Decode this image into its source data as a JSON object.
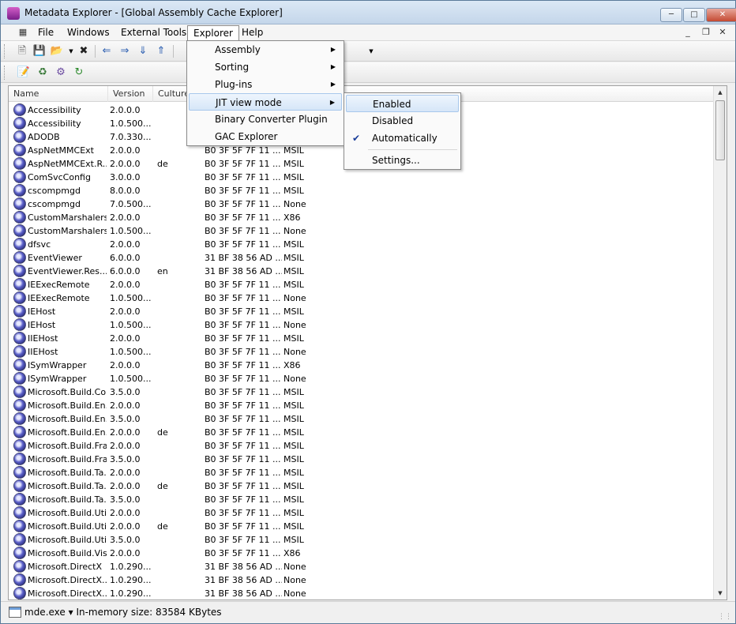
{
  "window": {
    "title": "Metadata Explorer - [Global Assembly Cache Explorer]"
  },
  "menubar": {
    "items": [
      "File",
      "Windows",
      "External Tools",
      "Explorer",
      "Help"
    ]
  },
  "columns": [
    "Name",
    "Version",
    "Culture"
  ],
  "rows": [
    [
      "Accessibility",
      "2.0.0.0",
      "",
      "",
      ""
    ],
    [
      "Accessibility",
      "1.0.500...",
      "",
      "",
      ""
    ],
    [
      "ADODB",
      "7.0.330...",
      "",
      "",
      ""
    ],
    [
      "AspNetMMCExt",
      "2.0.0.0",
      "",
      "B0 3F 5F 7F 11 ...",
      "MSIL"
    ],
    [
      "AspNetMMCExt.R...",
      "2.0.0.0",
      "de",
      "B0 3F 5F 7F 11 ...",
      "MSIL"
    ],
    [
      "ComSvcConfig",
      "3.0.0.0",
      "",
      "B0 3F 5F 7F 11 ...",
      "MSIL"
    ],
    [
      "cscompmgd",
      "8.0.0.0",
      "",
      "B0 3F 5F 7F 11 ...",
      "MSIL"
    ],
    [
      "cscompmgd",
      "7.0.500...",
      "",
      "B0 3F 5F 7F 11 ...",
      "None"
    ],
    [
      "CustomMarshalers",
      "2.0.0.0",
      "",
      "B0 3F 5F 7F 11 ...",
      "X86"
    ],
    [
      "CustomMarshalers",
      "1.0.500...",
      "",
      "B0 3F 5F 7F 11 ...",
      "None"
    ],
    [
      "dfsvc",
      "2.0.0.0",
      "",
      "B0 3F 5F 7F 11 ...",
      "MSIL"
    ],
    [
      "EventViewer",
      "6.0.0.0",
      "",
      "31 BF 38 56 AD ...",
      "MSIL"
    ],
    [
      "EventViewer.Res...",
      "6.0.0.0",
      "en",
      "31 BF 38 56 AD ...",
      "MSIL"
    ],
    [
      "IEExecRemote",
      "2.0.0.0",
      "",
      "B0 3F 5F 7F 11 ...",
      "MSIL"
    ],
    [
      "IEExecRemote",
      "1.0.500...",
      "",
      "B0 3F 5F 7F 11 ...",
      "None"
    ],
    [
      "IEHost",
      "2.0.0.0",
      "",
      "B0 3F 5F 7F 11 ...",
      "MSIL"
    ],
    [
      "IEHost",
      "1.0.500...",
      "",
      "B0 3F 5F 7F 11 ...",
      "None"
    ],
    [
      "IIEHost",
      "2.0.0.0",
      "",
      "B0 3F 5F 7F 11 ...",
      "MSIL"
    ],
    [
      "IIEHost",
      "1.0.500...",
      "",
      "B0 3F 5F 7F 11 ...",
      "None"
    ],
    [
      "ISymWrapper",
      "2.0.0.0",
      "",
      "B0 3F 5F 7F 11 ...",
      "X86"
    ],
    [
      "ISymWrapper",
      "1.0.500...",
      "",
      "B0 3F 5F 7F 11 ...",
      "None"
    ],
    [
      "Microsoft.Build.Co...",
      "3.5.0.0",
      "",
      "B0 3F 5F 7F 11 ...",
      "MSIL"
    ],
    [
      "Microsoft.Build.En...",
      "2.0.0.0",
      "",
      "B0 3F 5F 7F 11 ...",
      "MSIL"
    ],
    [
      "Microsoft.Build.En...",
      "3.5.0.0",
      "",
      "B0 3F 5F 7F 11 ...",
      "MSIL"
    ],
    [
      "Microsoft.Build.En...",
      "2.0.0.0",
      "de",
      "B0 3F 5F 7F 11 ...",
      "MSIL"
    ],
    [
      "Microsoft.Build.Fra...",
      "2.0.0.0",
      "",
      "B0 3F 5F 7F 11 ...",
      "MSIL"
    ],
    [
      "Microsoft.Build.Fra...",
      "3.5.0.0",
      "",
      "B0 3F 5F 7F 11 ...",
      "MSIL"
    ],
    [
      "Microsoft.Build.Ta...",
      "2.0.0.0",
      "",
      "B0 3F 5F 7F 11 ...",
      "MSIL"
    ],
    [
      "Microsoft.Build.Ta...",
      "2.0.0.0",
      "de",
      "B0 3F 5F 7F 11 ...",
      "MSIL"
    ],
    [
      "Microsoft.Build.Ta...",
      "3.5.0.0",
      "",
      "B0 3F 5F 7F 11 ...",
      "MSIL"
    ],
    [
      "Microsoft.Build.Util...",
      "2.0.0.0",
      "",
      "B0 3F 5F 7F 11 ...",
      "MSIL"
    ],
    [
      "Microsoft.Build.Util...",
      "2.0.0.0",
      "de",
      "B0 3F 5F 7F 11 ...",
      "MSIL"
    ],
    [
      "Microsoft.Build.Util...",
      "3.5.0.0",
      "",
      "B0 3F 5F 7F 11 ...",
      "MSIL"
    ],
    [
      "Microsoft.Build.Vis...",
      "2.0.0.0",
      "",
      "B0 3F 5F 7F 11 ...",
      "X86"
    ],
    [
      "Microsoft.DirectX",
      "1.0.290...",
      "",
      "31 BF 38 56 AD ...",
      "None"
    ],
    [
      "Microsoft.DirectX....",
      "1.0.290...",
      "",
      "31 BF 38 56 AD ...",
      "None"
    ],
    [
      "Microsoft.DirectX....",
      "1.0.290...",
      "",
      "31 BF 38 56 AD ...",
      "None"
    ]
  ],
  "explorer_menu": [
    "Assembly",
    "Sorting",
    "Plug-ins",
    "JIT view mode",
    "Binary Converter Plugin",
    "GAC Explorer"
  ],
  "jit_menu": [
    "Enabled",
    "Disabled",
    "Automatically",
    "Settings..."
  ],
  "status": {
    "text": "mde.exe  ▾  In-memory size: 83584 KBytes"
  }
}
